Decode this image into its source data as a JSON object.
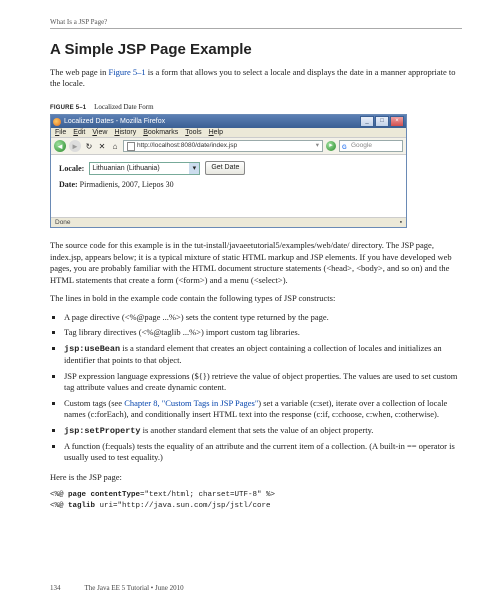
{
  "header": {
    "breadcrumb": "What Is a JSP Page?"
  },
  "title": "A Simple JSP Page Example",
  "intro_before_link": "The web page in ",
  "intro_link": "Figure 5–1",
  "intro_after_link": " is a form that allows you to select a locale and displays the date in a manner appropriate to the locale.",
  "figure": {
    "label": "FIGURE 5–1",
    "caption": "Localized Date Form"
  },
  "browser": {
    "title": "Localized Dates - Mozilla Firefox",
    "menus": [
      "File",
      "Edit",
      "View",
      "History",
      "Bookmarks",
      "Tools",
      "Help"
    ],
    "url": "http://localhost:8080/date/index.jsp",
    "search_placeholder": "Google",
    "form": {
      "locale_label": "Locale:",
      "locale_value": "Lithuanian (Lithuania)",
      "button": "Get Date",
      "date_label": "Date: ",
      "date_value": "Pirmadienis, 2007, Liepos 30"
    },
    "status": "Done"
  },
  "para_source": "The source code for this example is in the tut-install/javaeetutorial5/examples/web/date/ directory. The JSP page, index.jsp, appears below; it is a typical mixture of static HTML markup and JSP elements. If you have developed web pages, you are probably familiar with the HTML document structure statements (<head>, <body>, and so on) and the HTML statements that create a form (<form>) and a menu (<select>).",
  "para_bold_intro": "The lines in bold in the example code contain the following types of JSP constructs:",
  "bullets": {
    "b1": "A page directive (<%@page ...%>) sets the content type returned by the page.",
    "b2": "Tag library directives (<%@taglib ...%>) import custom tag libraries.",
    "b3_pre": "jsp:useBean",
    "b3_post": " is a standard element that creates an object containing a collection of locales and initializes an identifier that points to that object.",
    "b4": "JSP expression language expressions (${}) retrieve the value of object properties. The values are used to set custom tag attribute values and create dynamic content.",
    "b5_a": "Custom tags (see ",
    "b5_link": "Chapter 8, \"Custom Tags in JSP Pages\"",
    "b5_b": ") set a variable (c:set), iterate over a collection of locale names (c:forEach), and conditionally insert HTML text into the response (c:if, c:choose, c:when, c:otherwise).",
    "b6_pre": "jsp:setProperty",
    "b6_post": " is another standard element that sets the value of an object property.",
    "b7": "A function (f:equals) tests the equality of an attribute and the current item of a collection. (A built-in == operator is usually used to test equality.)"
  },
  "para_here": "Here is the JSP page:",
  "code": {
    "line1a": "<%@ ",
    "line1b": "page contentType",
    "line1c": "=\"text/html; charset=UTF-8\" %>",
    "line2a": "<%@ ",
    "line2b": "taglib",
    "line2c": " uri=\"http://java.sun.com/jsp/jstl/core"
  },
  "footer": {
    "page_num": "134",
    "book": "The Java EE 5 Tutorial  •  June 2010"
  }
}
